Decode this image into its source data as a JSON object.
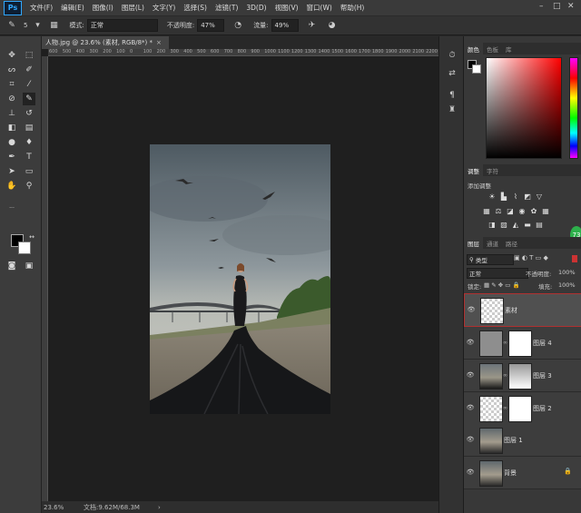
{
  "menubar": {
    "logo": "Ps",
    "items": [
      "文件(F)",
      "编辑(E)",
      "图像(I)",
      "图层(L)",
      "文字(Y)",
      "选择(S)",
      "滤镜(T)",
      "3D(D)",
      "视图(V)",
      "窗口(W)",
      "帮助(H)"
    ]
  },
  "options": {
    "brush_size": "5",
    "mode_label": "模式:",
    "mode_value": "正常",
    "opacity_label": "不透明度:",
    "opacity_value": "47%",
    "flow_label": "流量:",
    "flow_value": "49%"
  },
  "document": {
    "tab_title": "人物.jpg @ 23.6% (素材, RGB/8*) *",
    "ruler_ticks": [
      "600",
      "500",
      "400",
      "300",
      "200",
      "100",
      "0",
      "100",
      "200",
      "300",
      "400",
      "500",
      "600",
      "700",
      "800",
      "900",
      "1000",
      "1100",
      "1200",
      "1300",
      "1400",
      "1500",
      "1600",
      "1700",
      "1800",
      "1900",
      "2000",
      "2100",
      "2200"
    ],
    "zoom": "23.6%",
    "doc_info": "文档:9.62M/68.3M"
  },
  "color_panel": {
    "tabs": [
      "颜色",
      "色板",
      "库"
    ],
    "accent": "#ff0000"
  },
  "adjust_panel": {
    "tabs": [
      "调整",
      "字符"
    ],
    "title": "添加调整"
  },
  "layers_panel": {
    "tabs": [
      "图层",
      "通道",
      "路径"
    ],
    "filter_label": "类型",
    "blend_mode": "正常",
    "opacity_label": "不透明度:",
    "opacity_value": "100%",
    "lock_label": "锁定:",
    "fill_label": "填充:",
    "fill_value": "100%",
    "layers": [
      {
        "name": "素材",
        "selected": true
      },
      {
        "name": "图层 4",
        "selected": false
      },
      {
        "name": "图层 3",
        "selected": false
      },
      {
        "name": "图层 2",
        "selected": false
      },
      {
        "name": "图层 1",
        "selected": false
      },
      {
        "name": "背景",
        "selected": false
      }
    ]
  },
  "badge": "73"
}
